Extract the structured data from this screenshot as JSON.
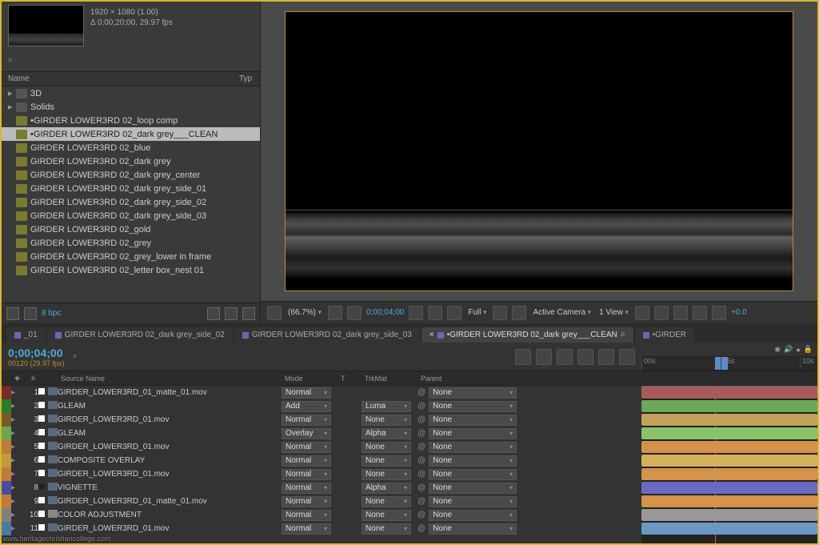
{
  "watermark": "www.heritagechristiancollege.com",
  "project": {
    "thumb_meta1": "1920 × 1080 (1.00)",
    "thumb_meta2": "Δ 0;00;20;00, 29.97 fps",
    "search_placeholder": "",
    "col_name": "Name",
    "col_type": "Typ",
    "bpc": "8 bpc",
    "items": [
      {
        "type": "folder",
        "label": "3D",
        "arrow": "▸"
      },
      {
        "type": "folder",
        "label": "Solids",
        "arrow": "▸"
      },
      {
        "type": "comp",
        "label": "•GIRDER LOWER3RD 02_loop comp"
      },
      {
        "type": "comp",
        "label": "•GIRDER LOWER3RD 02_dark grey___CLEAN",
        "sel": true
      },
      {
        "type": "comp",
        "label": "GIRDER LOWER3RD 02_blue"
      },
      {
        "type": "comp",
        "label": "GIRDER LOWER3RD 02_dark grey"
      },
      {
        "type": "comp",
        "label": "GIRDER LOWER3RD 02_dark grey_center"
      },
      {
        "type": "comp",
        "label": "GIRDER LOWER3RD 02_dark grey_side_01"
      },
      {
        "type": "comp",
        "label": "GIRDER LOWER3RD 02_dark grey_side_02"
      },
      {
        "type": "comp",
        "label": "GIRDER LOWER3RD 02_dark grey_side_03"
      },
      {
        "type": "comp",
        "label": "GIRDER LOWER3RD 02_gold"
      },
      {
        "type": "comp",
        "label": "GIRDER LOWER3RD 02_grey"
      },
      {
        "type": "comp",
        "label": "GIRDER LOWER3RD 02_grey_lower in frame"
      },
      {
        "type": "comp",
        "label": "GIRDER LOWER3RD 02_letter box_nest 01"
      }
    ]
  },
  "viewer": {
    "zoom": "(66.7%)",
    "timecode": "0;00;04;00",
    "res": "Full",
    "camera": "Active Camera",
    "views": "1 View",
    "exposure": "+0.0"
  },
  "timeline": {
    "tabs": [
      {
        "label": "_01"
      },
      {
        "label": "GIRDER LOWER3RD 02_dark grey_side_02"
      },
      {
        "label": "GIRDER LOWER3RD 02_dark grey_side_03"
      },
      {
        "label": "•GIRDER LOWER3RD 02_dark grey___CLEAN",
        "active": true
      },
      {
        "label": "•GIRDER"
      }
    ],
    "timecode": "0;00;04;00",
    "timedetail": "00120 (29.97 fps)",
    "ruler": [
      "00s",
      "05s",
      "10s"
    ],
    "hdr": {
      "num": "#",
      "srcname": "Source Name",
      "mode": "Mode",
      "t": "T",
      "trk": "TrkMat",
      "parent": "Parent"
    },
    "layers": [
      {
        "n": 1,
        "name": "GIRDER_LOWER3RD_01_matte_01.mov",
        "mode": "Normal",
        "trk": "",
        "parent": "None",
        "lswatch": ""
      },
      {
        "n": 2,
        "name": "GLEAM",
        "mode": "Add",
        "trk": "Luma",
        "parent": "None",
        "lswatch": ""
      },
      {
        "n": 3,
        "name": "GIRDER_LOWER3RD_01.mov",
        "mode": "Normal",
        "trk": "None",
        "parent": "None",
        "lswatch": ""
      },
      {
        "n": 4,
        "name": "GLEAM",
        "mode": "Overlay",
        "trk": "Alpha",
        "parent": "None",
        "lswatch": ""
      },
      {
        "n": 5,
        "name": "GIRDER_LOWER3RD_01.mov",
        "mode": "Normal",
        "trk": "None",
        "parent": "None",
        "lswatch": ""
      },
      {
        "n": 6,
        "name": "COMPOSITE OVERLAY",
        "mode": "Normal",
        "trk": "None",
        "parent": "None",
        "lswatch": ""
      },
      {
        "n": 7,
        "name": "GIRDER_LOWER3RD_01.mov",
        "mode": "Normal",
        "trk": "None",
        "parent": "None",
        "lswatch": ""
      },
      {
        "n": 8,
        "name": "VIGNETTE",
        "mode": "Normal",
        "trk": "Alpha",
        "parent": "None",
        "lswatch": "dark"
      },
      {
        "n": 9,
        "name": "GIRDER_LOWER3RD_01_matte_01.mov",
        "mode": "Normal",
        "trk": "None",
        "parent": "None",
        "lswatch": ""
      },
      {
        "n": 10,
        "name": "COLOR ADJUSTMENT",
        "mode": "Normal",
        "trk": "None",
        "parent": "None",
        "adj": true,
        "lswatch": ""
      },
      {
        "n": 11,
        "name": "GIRDER_LOWER3RD_01.mov",
        "mode": "Normal",
        "trk": "None",
        "parent": "None",
        "lswatch": ""
      }
    ]
  }
}
